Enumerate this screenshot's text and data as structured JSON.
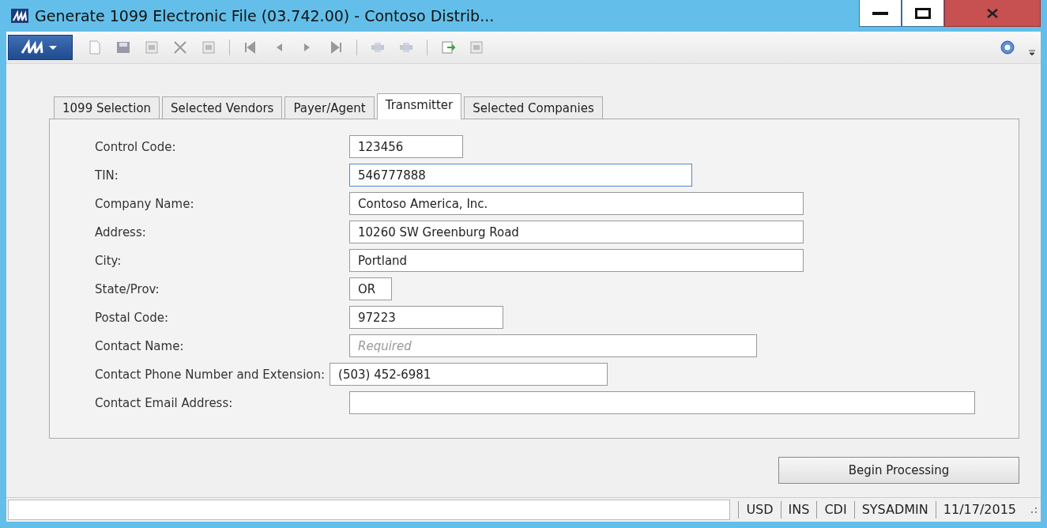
{
  "window": {
    "title": "Generate 1099 Electronic File (03.742.00) - Contoso Distrib..."
  },
  "tabs": [
    {
      "label": "1099 Selection",
      "selected": false
    },
    {
      "label": "Selected Vendors",
      "selected": false
    },
    {
      "label": "Payer/Agent",
      "selected": false
    },
    {
      "label": "Transmitter",
      "selected": true
    },
    {
      "label": "Selected Companies",
      "selected": false
    }
  ],
  "fields": [
    {
      "label": "Control Code:",
      "value": "123456",
      "focused": false
    },
    {
      "label": "TIN:",
      "value": "546777888",
      "focused": true
    },
    {
      "label": "Company Name:",
      "value": "Contoso America, Inc.",
      "focused": false
    },
    {
      "label": "Address:",
      "value": "10260 SW Greenburg Road",
      "focused": false
    },
    {
      "label": "City:",
      "value": "Portland",
      "focused": false
    },
    {
      "label": "State/Prov:",
      "value": "OR",
      "focused": false
    },
    {
      "label": "Postal Code:",
      "value": "97223",
      "focused": false
    },
    {
      "label": "Contact Name:",
      "placeholder": "Required",
      "focused": false
    },
    {
      "label": "Contact Phone Number and Extension:",
      "value": "(503) 452-6981",
      "focused": false
    },
    {
      "label": "Contact Email Address:",
      "focused": false
    }
  ],
  "buttons": [
    "Begin Processing"
  ],
  "status_bar": [
    "USD",
    "INS",
    "CDI",
    "SYSADMIN",
    "11/17/2015"
  ]
}
